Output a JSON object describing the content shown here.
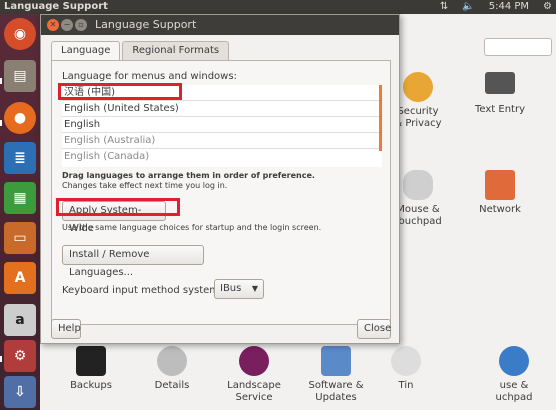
{
  "top_panel": {
    "title": "Language Support",
    "time": "5:44 PM"
  },
  "dialog": {
    "title": "Language Support",
    "tabs": [
      {
        "label": "Language"
      },
      {
        "label": "Regional Formats"
      }
    ],
    "languages_heading": "Language for menus and windows:",
    "languages": [
      "汉语 (中国)",
      "English (United States)",
      "English",
      "English (Australia)",
      "English (Canada)"
    ],
    "drag_hint": "Drag languages to arrange them in order of preference.",
    "changes_hint": "Changes take effect next time you log in.",
    "apply_button": "Apply System-Wide",
    "apply_description": "Use the same language choices for startup and the login screen.",
    "install_button": "Install / Remove Languages...",
    "keyboard_label": "Keyboard input method system:",
    "keyboard_value": "IBus",
    "help_button": "Help",
    "close_button": "Close"
  },
  "background": {
    "items": [
      {
        "label": "Security & Privacy"
      },
      {
        "label": "Text Entry"
      },
      {
        "label": "Mouse & Touchpad"
      },
      {
        "label": "Network"
      },
      {
        "label": "Backups"
      },
      {
        "label": "Details"
      },
      {
        "label": "Landscape Service"
      },
      {
        "label": "Software & Updates"
      },
      {
        "label": "Tin"
      },
      {
        "label": "use & uchpad"
      }
    ]
  },
  "colors": {
    "highlight": "#e0202c",
    "accent": "#e87c38",
    "launcher": "#4a2430",
    "panel": "#3b3a36"
  }
}
